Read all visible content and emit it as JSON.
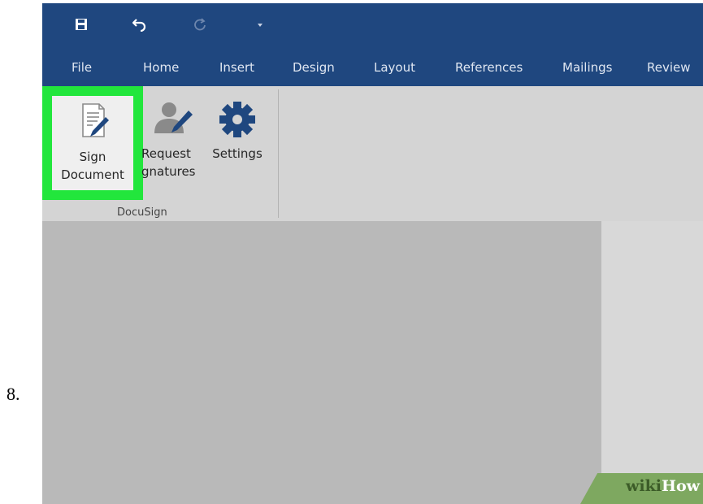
{
  "step_number": "8.",
  "quick_access_toolbar": {
    "items": [
      {
        "icon": "save-icon"
      },
      {
        "icon": "undo-icon"
      },
      {
        "icon": "redo-icon"
      },
      {
        "icon": "customize-toolbar-icon"
      }
    ]
  },
  "ribbon_tabs": [
    "File",
    "Home",
    "Insert",
    "Design",
    "Layout",
    "References",
    "Mailings",
    "Review"
  ],
  "ribbon": {
    "group_label": "DocuSign",
    "highlight_color": "#22e63c",
    "commands": {
      "sign_document": {
        "line1": "Sign",
        "line2": "Document",
        "icon": "sign-document-icon"
      },
      "request_signatures": {
        "line1": "Request",
        "line2": "gnatures",
        "icon": "request-signatures-icon"
      },
      "settings": {
        "line1": "Settings",
        "icon": "gear-icon"
      }
    }
  },
  "watermark": {
    "wiki": "wiki",
    "how": "How"
  },
  "colors": {
    "title_bar": "#1f477f",
    "ribbon_background": "#d4d4d4",
    "icon_blue": "#1f477f",
    "workspace": "#b9b9b9"
  }
}
